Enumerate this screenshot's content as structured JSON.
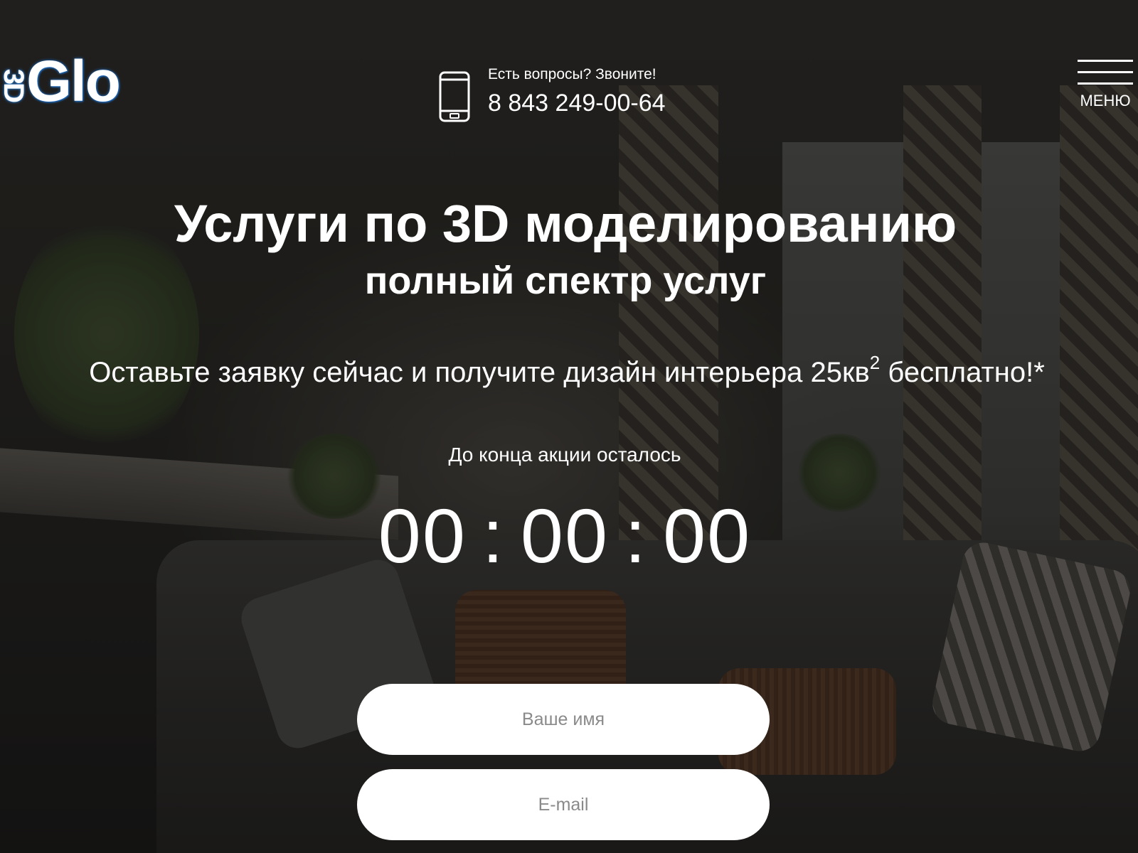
{
  "header": {
    "logo": {
      "prefix": "3D",
      "text": "Glo",
      "glow_color": "#1e73d0"
    },
    "contact": {
      "icon": "smartphone-icon",
      "question": "Есть вопросы? Звоните!",
      "phone": "8 843 249-00-64"
    },
    "menu": {
      "icon": "hamburger-icon",
      "label": "МЕНЮ"
    }
  },
  "hero": {
    "title": "Услуги по 3D моделированию",
    "subtitle": "полный спектр услуг",
    "offer_main": "Оставьте заявку сейчас и получите дизайн интерьера 25кв",
    "offer_sup": "2",
    "offer_tail": " бесплатно!*"
  },
  "timer": {
    "label": "До конца акции осталось",
    "hours": "00",
    "minutes": "00",
    "seconds": "00",
    "separator": ":"
  },
  "form": {
    "name_placeholder": "Ваше имя",
    "email_placeholder": "E-mail"
  },
  "colors": {
    "text": "#ffffff",
    "field_bg": "#ffffff",
    "placeholder": "#8a8a8a"
  }
}
